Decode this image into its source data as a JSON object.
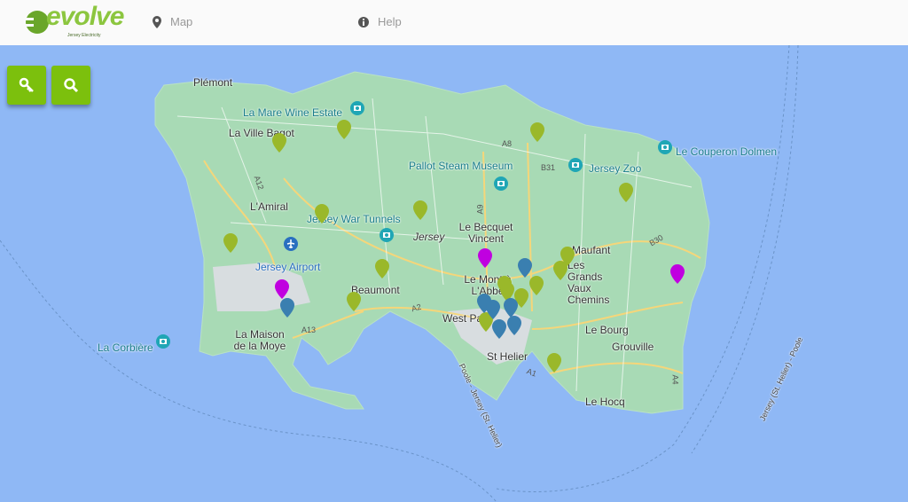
{
  "header": {
    "logo_text": "evolve",
    "logo_subtext": "Jersey Electricity",
    "nav": [
      {
        "label": "Map",
        "icon": "map-pin-icon"
      },
      {
        "label": "Help",
        "icon": "info-icon"
      }
    ]
  },
  "controls": [
    {
      "icon": "key-icon"
    },
    {
      "icon": "search-icon"
    }
  ],
  "colors": {
    "accent": "#7cc00d",
    "water": "#8fb8f5",
    "land": "#a8dab5",
    "marker_green": "#9ab82a",
    "marker_magenta": "#c000e0",
    "marker_blue": "#3a7fb0"
  },
  "places": [
    "Plémont",
    "La Ville Bagot",
    "L'Amiral",
    "Jersey Airport",
    "La Maison de la Moye",
    "Beaumont",
    "Jersey",
    "Le Becquet Vincent",
    "Le Mont à L'Abbé",
    "West Park",
    "St Helier",
    "Maufant",
    "Les Grands Vaux Chemins",
    "Le Bourg",
    "Grouville",
    "Le Hocq"
  ],
  "pois": [
    "La Mare Wine Estate",
    "Pallot Steam Museum",
    "Jersey Zoo",
    "Le Couperon Dolmen",
    "Jersey War Tunnels",
    "La Corbière"
  ],
  "roads": [
    "A12",
    "A8",
    "A9",
    "B31",
    "B30",
    "A2",
    "A13",
    "A1",
    "A4"
  ],
  "ferry_labels": [
    "Poole - Jersey (St. Helier)",
    "Jersey (St. Helier) - Poole"
  ]
}
